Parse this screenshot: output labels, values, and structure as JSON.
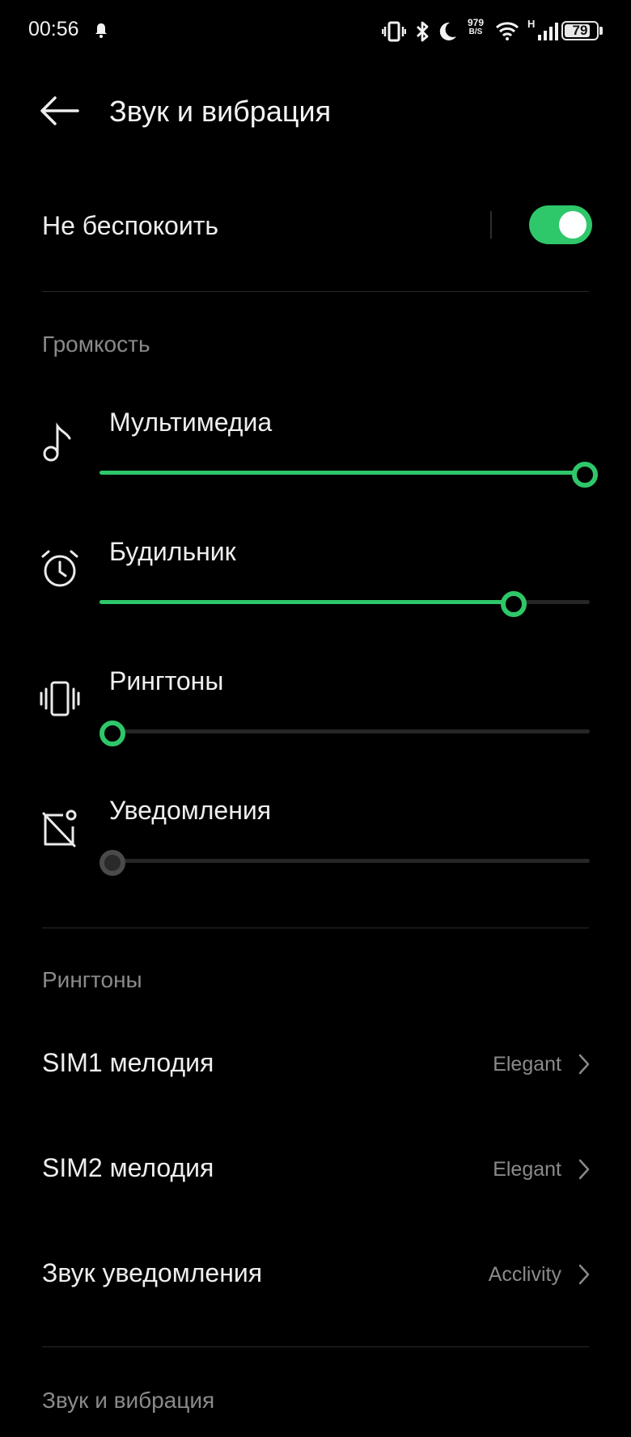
{
  "status_bar": {
    "time": "00:56",
    "net_speed_value": "979",
    "net_speed_unit": "B/S",
    "network_type": "H",
    "battery": "79",
    "icons": [
      "notification-bell-icon",
      "vibrate-icon",
      "bluetooth-icon",
      "moon-icon",
      "wifi-icon",
      "cell-signal-icon",
      "battery-icon"
    ]
  },
  "header": {
    "title": "Звук и вибрация",
    "back_icon": "arrow-left-icon"
  },
  "dnd": {
    "label": "Не беспокоить",
    "enabled": true
  },
  "volume": {
    "section_title": "Громкость",
    "sliders": [
      {
        "label": "Мультимедиа",
        "icon": "music-note-icon",
        "level": 1.0,
        "enabled": true
      },
      {
        "label": "Будильник",
        "icon": "alarm-clock-icon",
        "level": 0.85,
        "enabled": true
      },
      {
        "label": "Рингтоны",
        "icon": "vibrate-phone-icon",
        "level": 0.0,
        "enabled": true
      },
      {
        "label": "Уведомления",
        "icon": "notification-off-icon",
        "level": 0.0,
        "enabled": false
      }
    ]
  },
  "ringtones": {
    "section_title": "Рингтоны",
    "items": [
      {
        "label": "SIM1 мелодия",
        "value": "Elegant"
      },
      {
        "label": "SIM2 мелодия",
        "value": "Elegant"
      },
      {
        "label": "Звук уведомления",
        "value": "Acclivity"
      }
    ]
  },
  "sound_vibration": {
    "section_title": "Звук и вибрация"
  },
  "colors": {
    "accent": "#2ec76a",
    "background": "#000000",
    "section_header": "#8a8a8a"
  }
}
